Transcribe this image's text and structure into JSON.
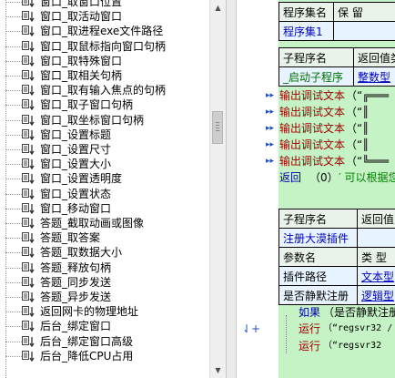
{
  "tree": {
    "items": [
      "窗口_取窗口位置",
      "窗口_取活动窗口",
      "窗口_取进程exe文件路径",
      "窗口_取鼠标指向窗口句柄",
      "窗口_取特殊窗口",
      "窗口_取相关句柄",
      "窗口_取有输入焦点的句柄",
      "窗口_取子窗口句柄",
      "窗口_取坐标窗口句柄",
      "窗口_设置标题",
      "窗口_设置尺寸",
      "窗口_设置大小",
      "窗口_设置透明度",
      "窗口_设置状态",
      "窗口_移动窗口",
      "答题_截取动画或图像",
      "答题_取答案",
      "答题_取数据大小",
      "答题_释放句柄",
      "答题_同步发送",
      "答题_异步发送",
      "返回网卡的物理地址",
      "后台_绑定窗口",
      "后台_绑定窗口高级",
      "后台_降低CPU占用"
    ]
  },
  "editor": {
    "table1": {
      "headers": [
        "程序集名",
        "保 留"
      ],
      "row": [
        "程序集1",
        ""
      ]
    },
    "table2": {
      "headers": [
        "子程序名",
        "返回值类"
      ],
      "row": [
        "_启动子程序",
        "整数型"
      ]
    },
    "code_lines": [
      {
        "kw": "输出调试文本",
        "rest": "（“╔═══"
      },
      {
        "kw": "输出调试文本",
        "rest": "（“║"
      },
      {
        "kw": "输出调试文本",
        "rest": "（“║"
      },
      {
        "kw": "输出调试文本",
        "rest": "（“║"
      },
      {
        "kw": "输出调试文本",
        "rest": "（“╚═══"
      }
    ],
    "return_line": {
      "kw": "返回",
      "rest": "（0）",
      "comment": "′ 可以根据您"
    },
    "table3": {
      "headers": [
        "子程序名",
        "返回值"
      ],
      "row1": [
        "注册大漠插件",
        ""
      ],
      "row2": [
        "参数名",
        "类 型"
      ],
      "row3": [
        "插件路径",
        "文本型"
      ],
      "row4": [
        "是否静默注册",
        "逻辑型"
      ]
    },
    "flow": [
      {
        "kw": "如果",
        "rest": "（是否静默注册"
      },
      {
        "kw": "运行",
        "rest": "（“regsvr32 /"
      },
      {
        "kw": "运行",
        "rest": "（“regsvr32 "
      }
    ]
  },
  "scrollbar": {
    "up": "▲",
    "down": "▼"
  },
  "gutter_glyphs": {
    "arrow": "▸▸",
    "fold": "⇃+"
  }
}
